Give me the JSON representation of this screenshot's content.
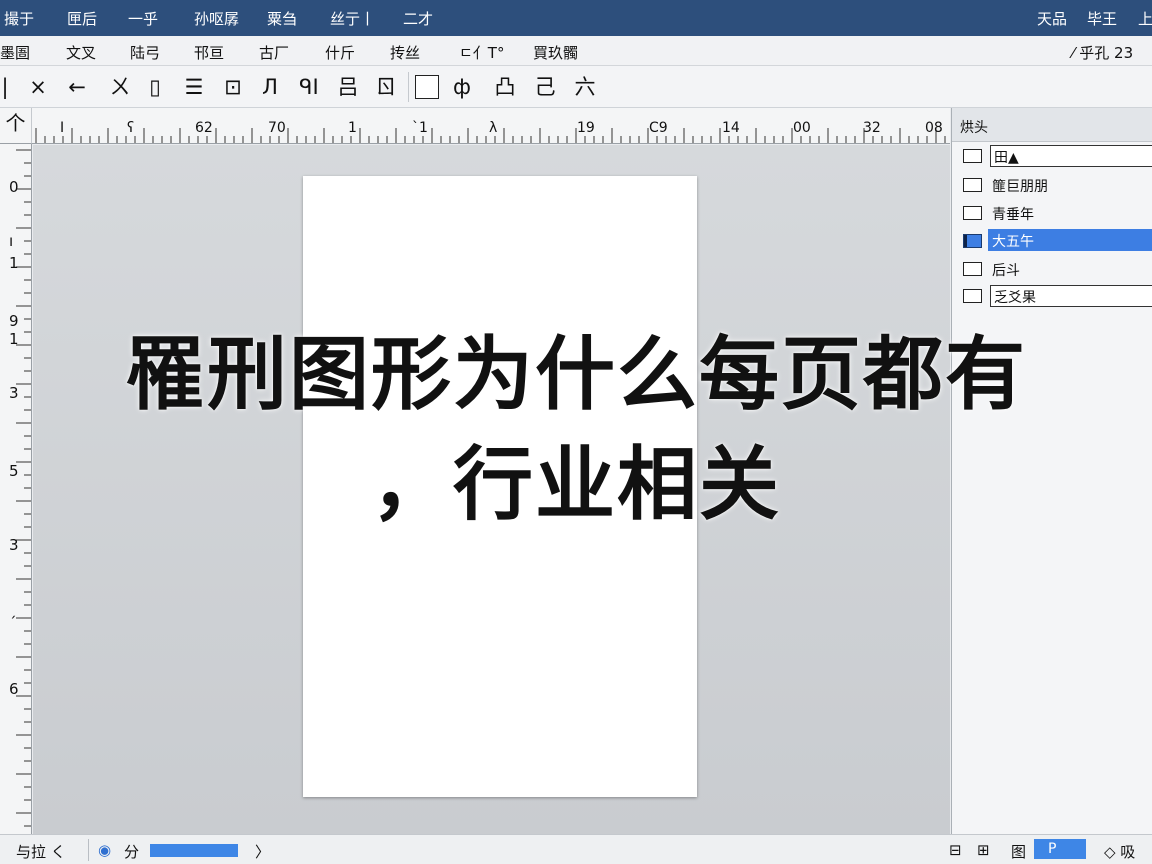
{
  "topbar": {
    "left_items": [
      "撮于",
      "匣后",
      "一乎",
      "孙呕孱",
      "粟刍",
      "丝亍丨",
      "二才"
    ],
    "right_items": [
      "天品",
      "毕王",
      "上"
    ]
  },
  "menurow": {
    "items": [
      "墨圄",
      "文叉",
      "陆弓",
      "邗亘",
      "古厂",
      "什斤",
      "抟丝",
      "ㄷ亻T°",
      "買玖髑"
    ],
    "right": "⁄ 乎孔 23"
  },
  "toolbar": {
    "tools": [
      "|",
      "×",
      "←",
      "ㄨ",
      "▯",
      "☰",
      "⊡",
      "Л",
      "ᑫI",
      "吕",
      "ㄖ",
      "",
      "ф",
      "凸",
      "己",
      "六"
    ]
  },
  "ruler": {
    "corner": "个",
    "h_labels": [
      "I",
      "ʕ",
      "62",
      "70",
      "1",
      "ˋ1",
      "λ",
      "19",
      "C9",
      "14",
      "00",
      "32",
      "08"
    ],
    "v_labels": [
      "0",
      "ı",
      "1",
      "9",
      "1",
      "3",
      "5",
      "3",
      "ˊ",
      "6"
    ]
  },
  "panel": {
    "title": "烘头",
    "layers": [
      {
        "name": "田▲",
        "style": "field"
      },
      {
        "name": "篚巨朋朋",
        "style": "normal"
      },
      {
        "name": "青垂年",
        "style": "normal"
      },
      {
        "name": "大五午",
        "style": "selected"
      },
      {
        "name": "后斗",
        "style": "normal"
      },
      {
        "name": "乏爻果",
        "style": "field"
      }
    ]
  },
  "status": {
    "left_label": "与拉 く",
    "zoom_icon_label": "分",
    "next_arrow": "〉",
    "right_items": [
      "⊟",
      "⊞",
      "图"
    ],
    "blue_btn": "P",
    "last": "◇ 吸"
  },
  "overlay": {
    "line1": "罹刑图形为什么每页都有",
    "line2": "，行业相关"
  },
  "colors": {
    "topbar_bg": "#2d4f7c",
    "selection": "#3d7ee3",
    "canvas_bg": "#cfd2d5"
  }
}
